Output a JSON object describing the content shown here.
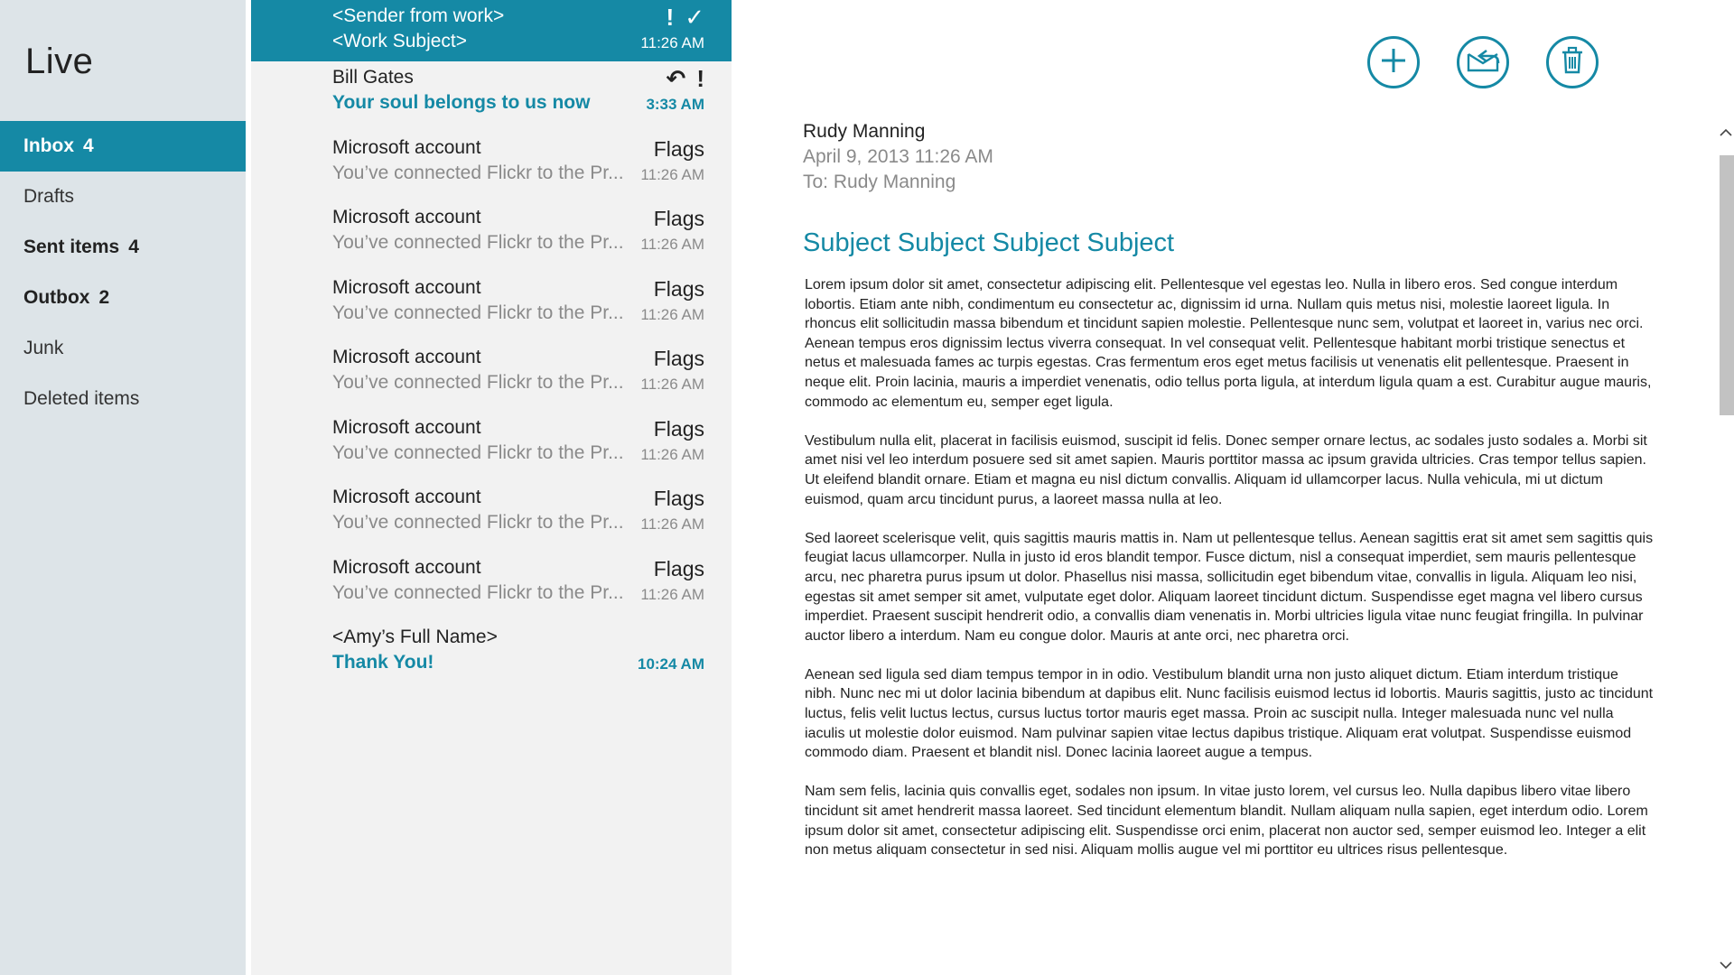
{
  "nav": {
    "app_title": "Live",
    "items": [
      {
        "label": "Inbox",
        "count": "4"
      },
      {
        "label": "Drafts",
        "count": ""
      },
      {
        "label": "Sent items",
        "count": "4"
      },
      {
        "label": "Outbox",
        "count": "2"
      },
      {
        "label": "Junk",
        "count": ""
      },
      {
        "label": "Deleted items",
        "count": ""
      }
    ]
  },
  "messages": [
    {
      "from": "<Sender from work>",
      "subject": "<Work Subject>",
      "time": "11:26 AM",
      "indicators": [
        "!",
        "✓"
      ]
    },
    {
      "from": "Bill Gates",
      "subject": "Your soul belongs to us now",
      "time": "3:33 AM",
      "indicators": [
        "↶",
        "!"
      ]
    },
    {
      "from": "Microsoft account",
      "subject": "You’ve connected Flickr to the Pr...",
      "time": "11:26 AM",
      "flag": "Flags"
    },
    {
      "from": "Microsoft account",
      "subject": "You’ve connected Flickr to the Pr...",
      "time": "11:26 AM",
      "flag": "Flags"
    },
    {
      "from": "Microsoft account",
      "subject": "You’ve connected Flickr to the Pr...",
      "time": "11:26 AM",
      "flag": "Flags"
    },
    {
      "from": "Microsoft account",
      "subject": "You’ve connected Flickr to the Pr...",
      "time": "11:26 AM",
      "flag": "Flags"
    },
    {
      "from": "Microsoft account",
      "subject": "You’ve connected Flickr to the Pr...",
      "time": "11:26 AM",
      "flag": "Flags"
    },
    {
      "from": "Microsoft account",
      "subject": "You’ve connected Flickr to the Pr...",
      "time": "11:26 AM",
      "flag": "Flags"
    },
    {
      "from": "Microsoft account",
      "subject": "You’ve connected Flickr to the Pr...",
      "time": "11:26 AM",
      "flag": "Flags"
    },
    {
      "from": "<Amy’s Full Name>",
      "subject": "Thank You!",
      "time": "10:24 AM"
    }
  ],
  "reading": {
    "sender": "Rudy Manning",
    "date": "April 9, 2013  11:26 AM",
    "to": "To: Rudy Manning",
    "subject": "Subject Subject Subject Subject",
    "paragraphs": [
      "Lorem ipsum dolor sit amet, consectetur adipiscing elit. Pellentesque vel egestas leo. Nulla in libero eros. Sed congue interdum lobortis. Etiam ante nibh, condimentum eu consectetur ac, dignissim id urna. Nullam quis metus nisi, molestie laoreet ligula. In rhoncus elit sollicitudin massa bibendum et tincidunt sapien molestie. Pellentesque nunc sem, volutpat et laoreet in, varius nec orci. Aenean tempus eros dignissim lectus viverra consequat. In vel consequat velit. Pellentesque habitant morbi tristique senectus et netus et malesuada fames ac turpis egestas. Cras fermentum eros eget metus facilisis ut venenatis elit pellentesque. Praesent in neque elit. Proin lacinia, mauris a imperdiet venenatis, odio tellus porta ligula, at interdum ligula quam a est. Curabitur augue mauris, commodo ac elementum eu, semper eget ligula.",
      "Vestibulum nulla elit, placerat in facilisis euismod, suscipit id felis. Donec semper ornare lectus, ac sodales justo sodales a. Morbi sit amet nisi vel leo interdum posuere sed sit amet sapien. Mauris porttitor massa ac ipsum gravida ultricies. Cras tempor tellus sapien. Ut eleifend blandit ornare. Etiam et magna eu nisl dictum convallis. Aliquam id ullamcorper lacus. Nulla vehicula, mi ut dictum euismod, quam arcu tincidunt purus, a laoreet massa nulla at leo.",
      "Sed laoreet scelerisque velit, quis sagittis mauris mattis in. Nam ut pellentesque tellus. Aenean sagittis erat sit amet sem sagittis quis feugiat lacus ullamcorper. Nulla in justo id eros blandit tempor. Fusce dictum, nisl a consequat imperdiet, sem mauris pellentesque arcu, nec pharetra purus ipsum ut dolor. Phasellus nisi massa, sollicitudin eget bibendum vitae, convallis in ligula. Aliquam leo nisi, egestas sit amet semper sit amet, vulputate eget dolor. Aliquam laoreet tincidunt dictum. Suspendisse eget magna vel libero cursus imperdiet. Praesent suscipit hendrerit odio, a convallis diam venenatis in. Morbi ultricies ligula vitae nunc feugiat fringilla. In pulvinar auctor libero a interdum. Nam eu congue dolor. Mauris at ante orci, nec pharetra orci.",
      "Aenean sed ligula sed diam tempus tempor in in odio. Vestibulum blandit urna non justo aliquet dictum. Etiam interdum tristique nibh. Nunc nec mi ut dolor lacinia bibendum at dapibus elit. Nunc facilisis euismod lectus id lobortis. Mauris sagittis, justo ac tincidunt luctus, felis velit luctus lectus, cursus luctus tortor mauris eget massa. Proin ac suscipit nulla. Integer malesuada nunc vel nulla iaculis ut molestie dolor euismod. Nam pulvinar sapien vitae lectus dapibus tristique. Aliquam erat volutpat. Suspendisse euismod commodo diam. Praesent et blandit nisl. Donec lacinia laoreet augue a tempus.",
      "Nam sem felis, lacinia quis convallis eget, sodales non ipsum. In vitae justo lorem, vel cursus leo. Nulla dapibus libero vitae libero tincidunt sit amet hendrerit massa laoreet. Sed tincidunt elementum blandit. Nullam aliquam nulla sapien, eget interdum odio. Lorem ipsum dolor sit amet, consectetur adipiscing elit. Suspendisse orci enim, placerat non auctor sed, semper euismod leo. Integer a elit non metus aliquam consectetur in sed nisi. Aliquam mollis augue vel mi porttitor eu ultrices risus pellentesque."
    ]
  },
  "actions": [
    {
      "icon": "plus-circle-icon",
      "name": "new-message-button"
    },
    {
      "icon": "reply-circle-icon",
      "name": "respond-button"
    },
    {
      "icon": "trash-circle-icon",
      "name": "delete-button"
    }
  ],
  "colors": {
    "accent": "#1589a5",
    "nav_background": "#dde4e8",
    "list_background": "#f2f2f2",
    "muted_text": "#8a8a8a"
  }
}
